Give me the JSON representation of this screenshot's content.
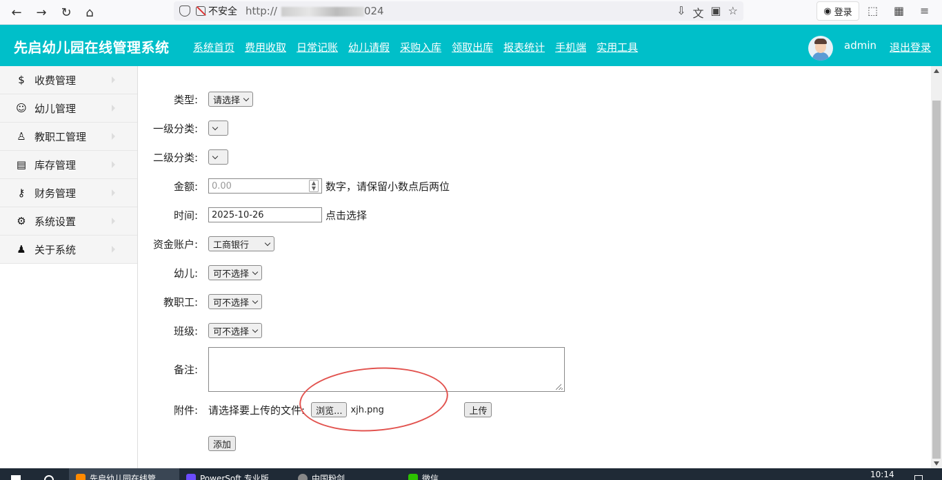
{
  "browser": {
    "insecure_label": "不安全",
    "url_prefix": "http://",
    "url_suffix": "024",
    "login_label": "登录"
  },
  "header": {
    "title": "先启幼儿园在线管理系统",
    "nav": [
      "系统首页",
      "费用收取",
      "日常记账",
      "幼儿请假",
      "采购入库",
      "领取出库",
      "报表统计",
      "手机端",
      "实用工具"
    ],
    "user": "admin",
    "logout": "退出登录"
  },
  "sidebar": {
    "items": [
      {
        "label": "收费管理",
        "icon": "money-bag-icon"
      },
      {
        "label": "幼儿管理",
        "icon": "child-icon"
      },
      {
        "label": "教职工管理",
        "icon": "staff-icon"
      },
      {
        "label": "库存管理",
        "icon": "inventory-icon"
      },
      {
        "label": "财务管理",
        "icon": "key-icon"
      },
      {
        "label": "系统设置",
        "icon": "gear-icon"
      },
      {
        "label": "关于系统",
        "icon": "user-icon"
      }
    ]
  },
  "form": {
    "type_label": "类型:",
    "type_value": "请选择",
    "cat1_label": "一级分类:",
    "cat2_label": "二级分类:",
    "amount_label": "金额:",
    "amount_placeholder": "0.00",
    "amount_hint": "数字，请保留小数点后两位",
    "time_label": "时间:",
    "time_value": "2025-10-26",
    "time_hint": "点击选择",
    "account_label": "资金账户:",
    "account_value": "工商银行",
    "child_label": "幼儿:",
    "child_value": "可不选择",
    "staff_label": "教职工:",
    "staff_value": "可不选择",
    "class_label": "班级:",
    "class_value": "可不选择",
    "note_label": "备注:",
    "attach_label": "附件:",
    "attach_prompt": "请选择要上传的文件:",
    "browse_label": "浏览...",
    "file_name": "xjh.png",
    "upload_label": "上传",
    "submit_label": "添加"
  },
  "taskbar": {
    "items": [
      "先启幼儿园在线管",
      "PowerSoft 专业版",
      "中国粉剑",
      "微信"
    ],
    "clock": "10:14"
  },
  "colors": {
    "header_bg": "#00bfc9",
    "annotation_circle": "#e2534f"
  }
}
